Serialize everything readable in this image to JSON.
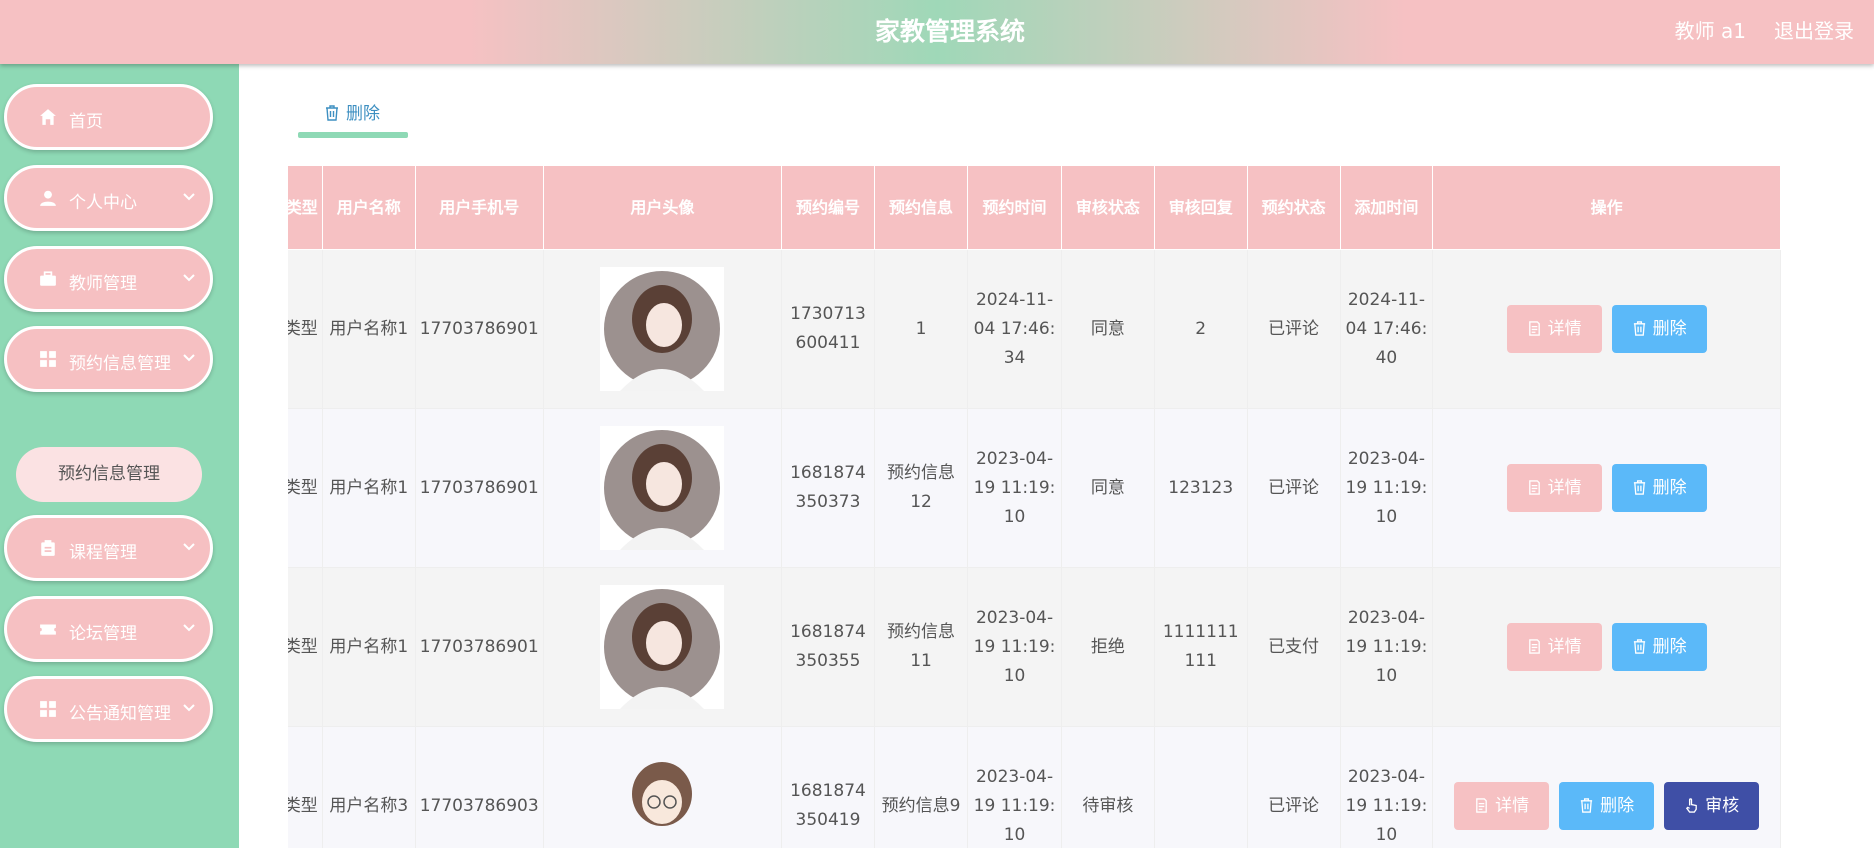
{
  "header": {
    "title": "家教管理系统",
    "user": "教师 a1",
    "logout": "退出登录"
  },
  "sidebar": {
    "items": [
      {
        "label": "首页",
        "icon": "home-icon"
      },
      {
        "label": "个人中心",
        "icon": "user-icon"
      },
      {
        "label": "教师管理",
        "icon": "briefcase-icon"
      },
      {
        "label": "预约信息管理",
        "icon": "grid-icon"
      },
      {
        "label": "课程管理",
        "icon": "clipboard-icon"
      },
      {
        "label": "论坛管理",
        "icon": "ticket-icon"
      },
      {
        "label": "公告通知管理",
        "icon": "grid-icon"
      }
    ],
    "submenu": {
      "label": "预约信息管理"
    }
  },
  "toolbar": {
    "delete_tab": "删除"
  },
  "table": {
    "columns": [
      "类型",
      "用户名称",
      "用户手机号",
      "用户头像",
      "预约编号",
      "预约信息",
      "预约时间",
      "审核状态",
      "审核回复",
      "预约状态",
      "添加时间",
      "操作"
    ],
    "rows": [
      {
        "type": "类型",
        "user_name": "用户名称1",
        "phone": "17703786901",
        "booking_no": "1730713600411",
        "info": "1",
        "booking_time": "2024-11-04 17:46:34",
        "review_status": "同意",
        "review_reply": "2",
        "booking_status": "已评论",
        "added_time": "2024-11-04 17:46:40"
      },
      {
        "type": "类型",
        "user_name": "用户名称1",
        "phone": "17703786901",
        "booking_no": "1681874350373",
        "info": "预约信息12",
        "booking_time": "2023-04-19 11:19:10",
        "review_status": "同意",
        "review_reply": "123123",
        "booking_status": "已评论",
        "added_time": "2023-04-19 11:19:10"
      },
      {
        "type": "类型",
        "user_name": "用户名称1",
        "phone": "17703786901",
        "booking_no": "1681874350355",
        "info": "预约信息11",
        "booking_time": "2023-04-19 11:19:10",
        "review_status": "拒绝",
        "review_reply": "1111111111",
        "booking_status": "已支付",
        "added_time": "2023-04-19 11:19:10"
      },
      {
        "type": "类型",
        "user_name": "用户名称3",
        "phone": "17703786903",
        "booking_no": "1681874350419",
        "info": "预约信息9",
        "booking_time": "2023-04-19 11:19:10",
        "review_status": "待审核",
        "review_reply": "",
        "booking_status": "已评论",
        "added_time": "2023-04-19 11:19:10"
      }
    ],
    "actions": {
      "detail": "详情",
      "delete": "删除",
      "review": "审核"
    }
  },
  "colors": {
    "pink": "#f6c1c3",
    "green": "#8ed9b5",
    "blue": "#5bb9f9",
    "indigo": "#3f4fa6"
  }
}
